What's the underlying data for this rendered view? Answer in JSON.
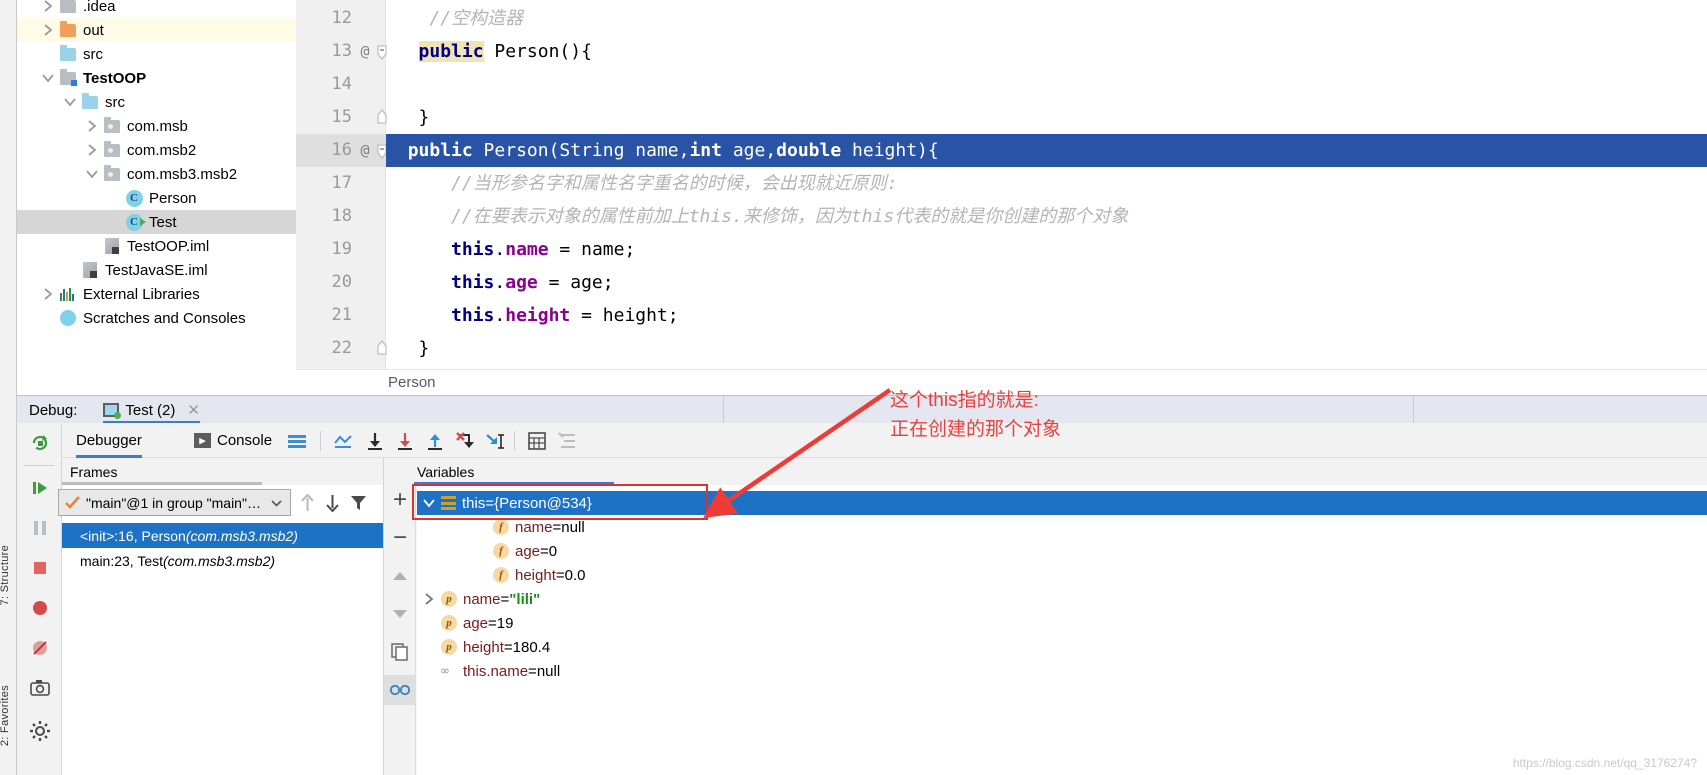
{
  "project_tree": [
    {
      "label": ".idea",
      "indent": 1,
      "icon": "folder-grey",
      "arrow": "right",
      "highlight": "none",
      "bold": false,
      "clipped": true
    },
    {
      "label": "out",
      "indent": 1,
      "icon": "folder-orange",
      "arrow": "right",
      "highlight": "yellow",
      "bold": false
    },
    {
      "label": "src",
      "indent": 1,
      "icon": "folder-blue",
      "arrow": "none",
      "highlight": "none",
      "bold": false
    },
    {
      "label": "TestOOP",
      "indent": 1,
      "icon": "module-grey",
      "arrow": "down",
      "highlight": "none",
      "bold": true
    },
    {
      "label": "src",
      "indent": 2,
      "icon": "folder-blue",
      "arrow": "down",
      "highlight": "none",
      "bold": false
    },
    {
      "label": "com.msb",
      "indent": 3,
      "icon": "package",
      "arrow": "right",
      "highlight": "none",
      "bold": false
    },
    {
      "label": "com.msb2",
      "indent": 3,
      "icon": "package",
      "arrow": "right",
      "highlight": "none",
      "bold": false
    },
    {
      "label": "com.msb3.msb2",
      "indent": 3,
      "icon": "package",
      "arrow": "down",
      "highlight": "none",
      "bold": false
    },
    {
      "label": "Person",
      "indent": 4,
      "icon": "class",
      "arrow": "none",
      "highlight": "none",
      "bold": false
    },
    {
      "label": "Test",
      "indent": 4,
      "icon": "class-runnable",
      "arrow": "none",
      "highlight": "grey",
      "bold": false
    },
    {
      "label": "TestOOP.iml",
      "indent": 3,
      "icon": "iml",
      "arrow": "none",
      "highlight": "none",
      "bold": false
    },
    {
      "label": "TestJavaSE.iml",
      "indent": 2,
      "icon": "iml",
      "arrow": "none",
      "highlight": "none",
      "bold": false
    },
    {
      "label": "External Libraries",
      "indent": 1,
      "icon": "libraries",
      "arrow": "right",
      "highlight": "none",
      "bold": false
    },
    {
      "label": "Scratches and Consoles",
      "indent": 1,
      "icon": "scratches",
      "arrow": "none",
      "highlight": "none",
      "bold": false
    }
  ],
  "editor": {
    "lines": [
      {
        "num": "12",
        "at": "",
        "fold": "none",
        "selected": false,
        "tokens": [
          {
            "t": "    ",
            "c": "plain"
          },
          {
            "t": "//空构造器",
            "c": "comment"
          }
        ]
      },
      {
        "num": "13",
        "at": "@",
        "fold": "open",
        "selected": false,
        "tokens": [
          {
            "t": "   ",
            "c": "plain"
          },
          {
            "t": "public",
            "c": "keyword-highlight"
          },
          {
            "t": " Person(){",
            "c": "plain"
          }
        ]
      },
      {
        "num": "14",
        "at": "",
        "fold": "none",
        "selected": false,
        "tokens": [
          {
            "t": "",
            "c": "plain"
          }
        ]
      },
      {
        "num": "15",
        "at": "",
        "fold": "close",
        "selected": false,
        "tokens": [
          {
            "t": "   }",
            "c": "plain"
          }
        ]
      },
      {
        "num": "16",
        "at": "@",
        "fold": "open",
        "selected": true,
        "tokens": [
          {
            "t": "  ",
            "c": "plain"
          },
          {
            "t": "public",
            "c": "keyword"
          },
          {
            "t": " Person(String name,",
            "c": "plain"
          },
          {
            "t": "int",
            "c": "keyword"
          },
          {
            "t": " age,",
            "c": "plain"
          },
          {
            "t": "double",
            "c": "keyword"
          },
          {
            "t": " height){",
            "c": "plain"
          }
        ]
      },
      {
        "num": "17",
        "at": "",
        "fold": "none",
        "selected": false,
        "tokens": [
          {
            "t": "      ",
            "c": "plain"
          },
          {
            "t": "//当形参名字和属性名字重名的时候，会出现就近原则:",
            "c": "comment"
          }
        ]
      },
      {
        "num": "18",
        "at": "",
        "fold": "none",
        "selected": false,
        "tokens": [
          {
            "t": "      ",
            "c": "plain"
          },
          {
            "t": "//在要表示对象的属性前加上this.来修饰，因为this代表的就是你创建的那个对象",
            "c": "comment"
          }
        ]
      },
      {
        "num": "19",
        "at": "",
        "fold": "none",
        "selected": false,
        "tokens": [
          {
            "t": "      ",
            "c": "plain"
          },
          {
            "t": "this",
            "c": "keyword"
          },
          {
            "t": ".",
            "c": "plain"
          },
          {
            "t": "name",
            "c": "field"
          },
          {
            "t": " = name;",
            "c": "plain"
          }
        ]
      },
      {
        "num": "20",
        "at": "",
        "fold": "none",
        "selected": false,
        "tokens": [
          {
            "t": "      ",
            "c": "plain"
          },
          {
            "t": "this",
            "c": "keyword"
          },
          {
            "t": ".",
            "c": "plain"
          },
          {
            "t": "age",
            "c": "field"
          },
          {
            "t": " = age;",
            "c": "plain"
          }
        ]
      },
      {
        "num": "21",
        "at": "",
        "fold": "none",
        "selected": false,
        "tokens": [
          {
            "t": "      ",
            "c": "plain"
          },
          {
            "t": "this",
            "c": "keyword"
          },
          {
            "t": ".",
            "c": "plain"
          },
          {
            "t": "height",
            "c": "field"
          },
          {
            "t": " = height;",
            "c": "plain"
          }
        ]
      },
      {
        "num": "22",
        "at": "",
        "fold": "close",
        "selected": false,
        "tokens": [
          {
            "t": "   }",
            "c": "plain"
          }
        ]
      }
    ],
    "breadcrumb": "Person"
  },
  "debug_bar": {
    "label": "Debug:",
    "tab_title": "Test (2)",
    "close_glyph": "✕"
  },
  "debugger": {
    "tabs": [
      {
        "label": "Debugger",
        "active": true
      },
      {
        "label": "Console",
        "active": false
      }
    ],
    "frames_header": "Frames",
    "variables_header": "Variables",
    "thread_selector": "\"main\"@1 in group \"main\"…",
    "frames": [
      {
        "label": "<init>:16, Person ",
        "pkg": "(com.msb3.msb2)",
        "selected": true
      },
      {
        "label": "main:23, Test ",
        "pkg": "(com.msb3.msb2)",
        "selected": false
      }
    ],
    "variables": [
      {
        "indent": 0,
        "arrow": "down",
        "icon": "object",
        "name": "this",
        "eq": " = ",
        "value": "{Person@534}",
        "value_kind": "plain",
        "selected": true
      },
      {
        "indent": 2,
        "arrow": "none",
        "icon": "field",
        "name": "name",
        "eq": " = ",
        "value": "null",
        "value_kind": "plain",
        "selected": false
      },
      {
        "indent": 2,
        "arrow": "none",
        "icon": "field",
        "name": "age",
        "eq": " = ",
        "value": "0",
        "value_kind": "plain",
        "selected": false
      },
      {
        "indent": 2,
        "arrow": "none",
        "icon": "field",
        "name": "height",
        "eq": " = ",
        "value": "0.0",
        "value_kind": "plain",
        "selected": false
      },
      {
        "indent": 0,
        "arrow": "right",
        "icon": "param",
        "name": "name",
        "eq": " = ",
        "value": "\"lili\"",
        "value_kind": "string",
        "selected": false
      },
      {
        "indent": 0,
        "arrow": "none",
        "icon": "param",
        "name": "age",
        "eq": " = ",
        "value": "19",
        "value_kind": "plain",
        "selected": false
      },
      {
        "indent": 0,
        "arrow": "none",
        "icon": "param",
        "name": "height",
        "eq": " = ",
        "value": "180.4",
        "value_kind": "plain",
        "selected": false
      },
      {
        "indent": 0,
        "arrow": "none",
        "icon": "watch",
        "name": "this.name",
        "eq": " = ",
        "value": "null",
        "value_kind": "plain",
        "selected": false
      }
    ]
  },
  "left_strip": {
    "items": [
      "7: Structure",
      "2: Favorites"
    ]
  },
  "annotation": {
    "text": "这个this指的就是:\n正在创建的那个对象",
    "color": "#e8413c"
  },
  "watermark": "https://blog.csdn.net/qq_3176274?",
  "colors": {
    "selection_blue": "#2953a5",
    "tree_selection": "#1e72c6",
    "accent_tab": "#3b7cd3",
    "annotation_red": "#e8413c",
    "keyword_navy": "#000080",
    "field_purple": "#8b0090",
    "string_green": "#1a8c1a"
  }
}
